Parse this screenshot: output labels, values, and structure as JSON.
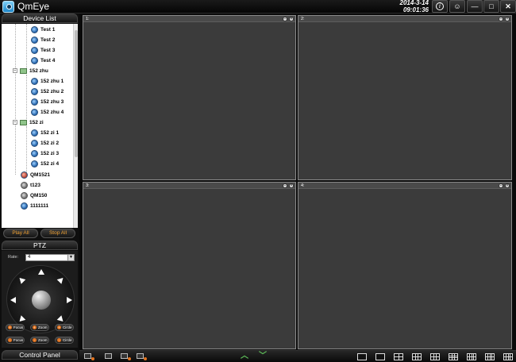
{
  "app": {
    "title": "QmEye"
  },
  "datetime": {
    "date": "2014-3-14",
    "time": "09:01:36"
  },
  "title_buttons": [
    {
      "name": "info-button",
      "icon": "info-icon",
      "glyph": "i"
    },
    {
      "name": "user-button",
      "icon": "user-icon",
      "glyph": "☺"
    },
    {
      "name": "minimize-button",
      "icon": "minimize-icon",
      "glyph": "—"
    },
    {
      "name": "maximize-button",
      "icon": "maximize-icon",
      "glyph": "□"
    },
    {
      "name": "close-button",
      "icon": "close-icon",
      "glyph": "✕"
    }
  ],
  "device_list": {
    "header": "Device List",
    "groups": [
      {
        "label": "",
        "children": [
          "Test 1",
          "Test 2",
          "Test 3",
          "Test 4"
        ]
      },
      {
        "label": "152 zhu",
        "children": [
          "152 zhu 1",
          "152 zhu 2",
          "152 zhu 3",
          "152 zhu 4"
        ]
      },
      {
        "label": "152 zi",
        "children": [
          "152 zi 1",
          "152 zi 2",
          "152 zi 3",
          "152 zi 4"
        ]
      }
    ],
    "devices": [
      "QM1521",
      "t123",
      "QM150",
      "1111111"
    ]
  },
  "play_controls": {
    "play_all": "Play All",
    "stop_all": "Stop All"
  },
  "ptz": {
    "header": "PTZ",
    "rate_label": "Rate:",
    "rate_value": "4",
    "buttons": [
      {
        "label": "Focus",
        "sign": "+"
      },
      {
        "label": "Zoom",
        "sign": "+"
      },
      {
        "label": "Circle",
        "sign": "+"
      },
      {
        "label": "Focus",
        "sign": "-"
      },
      {
        "label": "Zoom",
        "sign": "-"
      },
      {
        "label": "Circle",
        "sign": "-"
      }
    ]
  },
  "control_panel": {
    "header": "Control Panel"
  },
  "video_panes": [
    {
      "number": "1:"
    },
    {
      "number": "2:"
    },
    {
      "number": "3:"
    },
    {
      "number": "4:"
    }
  ],
  "colors": {
    "accent_orange": "#e2731f",
    "accent_green": "#5fc05a",
    "pane_bg": "#3b3b3b"
  }
}
